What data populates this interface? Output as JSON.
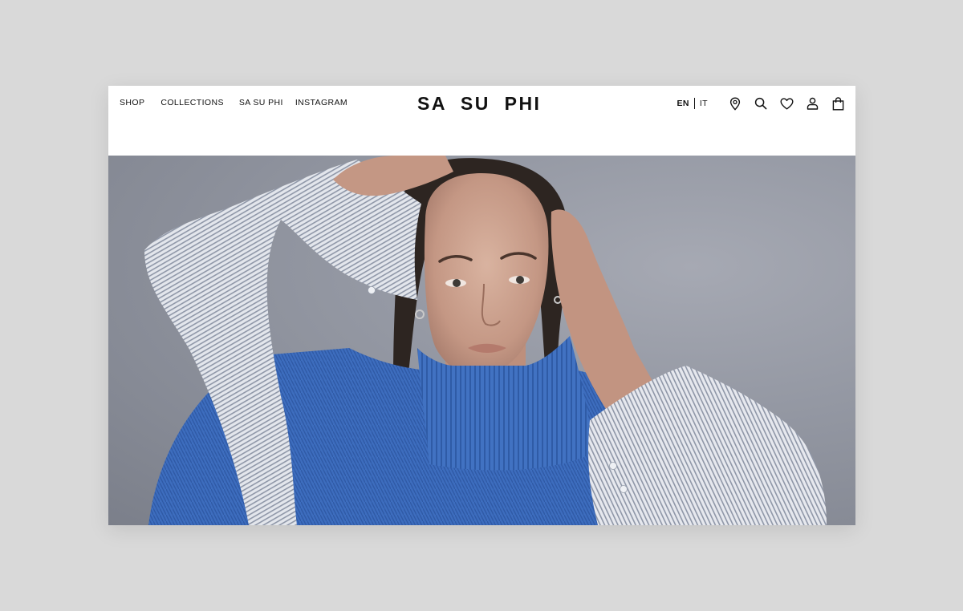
{
  "nav": {
    "shop": "SHOP",
    "collections": "COLLECTIONS",
    "brand": "SA SU PHI",
    "instagram": "INSTAGRAM"
  },
  "logo": "SA  SU  PHI",
  "lang": {
    "en": "EN",
    "it": "IT"
  },
  "icons": [
    "location-pin-icon",
    "search-icon",
    "heart-icon",
    "user-icon",
    "shopping-bag-icon"
  ],
  "colors": {
    "page_bg": "#d9d9d9",
    "text": "#111111",
    "sweater": "#3f6fc0",
    "shirt": "#d8dbe2"
  }
}
